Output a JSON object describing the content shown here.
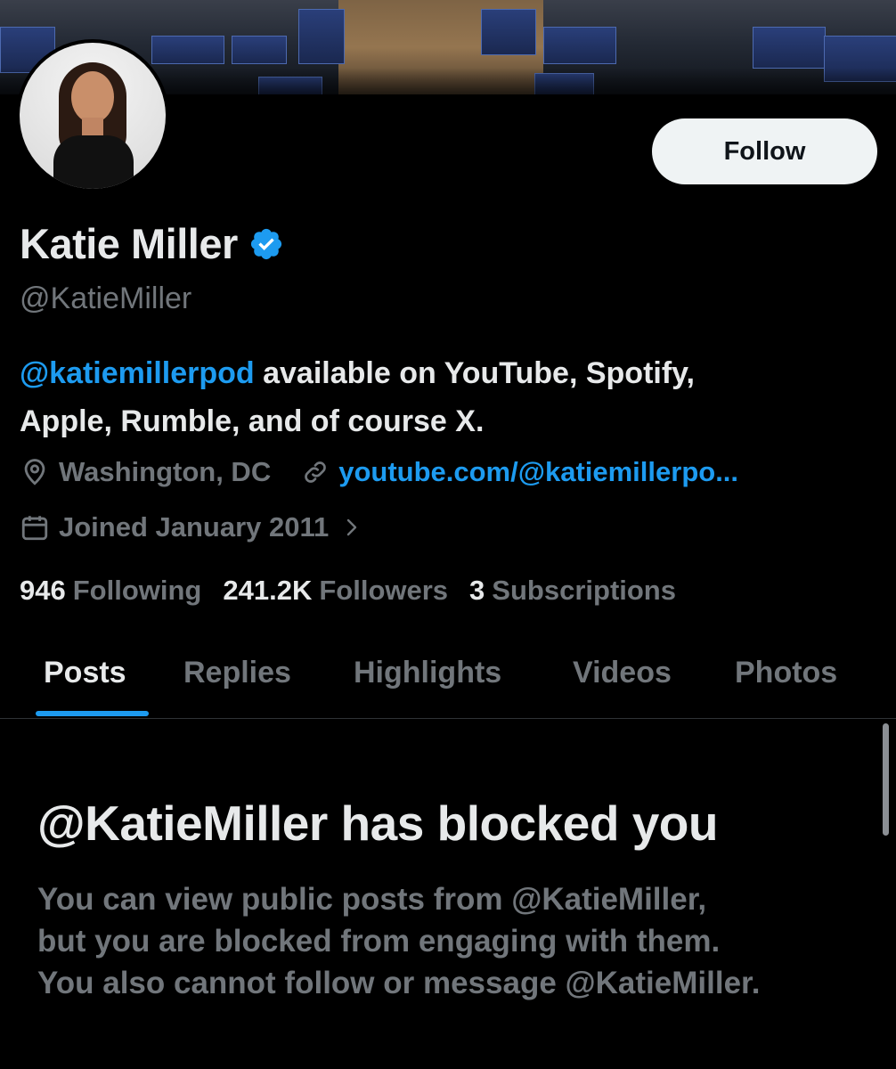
{
  "profile": {
    "display_name": "Katie Miller",
    "handle": "@KatieMiller",
    "verified_icon": "verified-badge-icon",
    "follow_label": "Follow",
    "bio_mention": "@katiemillerpod",
    "bio_line1_rest": " available on YouTube, Spotify,",
    "bio_line2": "Apple, Rumble, and of course X.",
    "location": "Washington, DC",
    "website": "youtube.com/@katiemillerpo...",
    "joined": "Joined January 2011"
  },
  "stats": {
    "following_count": "946",
    "following_label": "Following",
    "followers_count": "241.2K",
    "followers_label": "Followers",
    "subscriptions_count": "3",
    "subscriptions_label": "Subscriptions"
  },
  "tabs": [
    {
      "label": "Posts",
      "active": true
    },
    {
      "label": "Replies",
      "active": false
    },
    {
      "label": "Highlights",
      "active": false
    },
    {
      "label": "Videos",
      "active": false
    },
    {
      "label": "Photos",
      "active": false
    }
  ],
  "blocked": {
    "title": "@KatieMiller has blocked you",
    "line1": "You can view public posts from @KatieMiller,",
    "line2": "but you are blocked from engaging with them.",
    "line3": "You also cannot follow or message @KatieMiller."
  },
  "colors": {
    "background": "#000000",
    "accent": "#1d9bf0",
    "text_primary": "#e7e9ea",
    "text_secondary": "#71767b"
  }
}
